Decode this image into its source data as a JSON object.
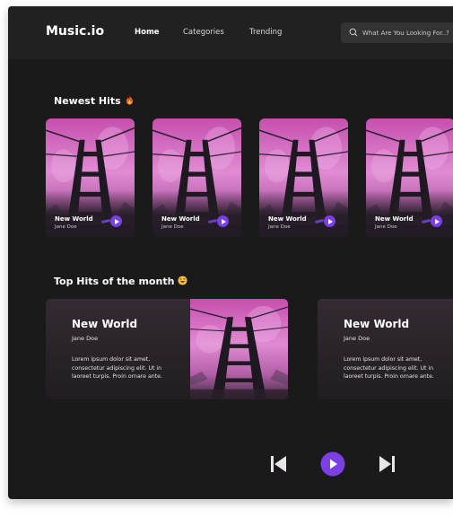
{
  "app": {
    "logo": "Music.io"
  },
  "nav": {
    "items": [
      "Home",
      "Categories",
      "Trending"
    ],
    "active": "Home"
  },
  "search": {
    "placeholder": "What Are You Looking For..?"
  },
  "newest": {
    "title": "Newest Hits",
    "emoji_icon": "fire-icon",
    "cards": [
      {
        "title": "New World",
        "artist": "Jane Doe"
      },
      {
        "title": "New World",
        "artist": "Jane Doe"
      },
      {
        "title": "New World",
        "artist": "Jane Doe"
      },
      {
        "title": "New World",
        "artist": "Jane Doe"
      }
    ]
  },
  "top_month": {
    "title": "Top Hits of the month",
    "emoji_icon": "grinning-face-icon",
    "cards": [
      {
        "title": "New World",
        "artist": "Jane Doe",
        "description": "Lorem ipsum dolor sit amet, consectetur adipiscing elit. Ut in laoreet turpis. Proin ornare ante."
      },
      {
        "title": "New World",
        "artist": "Jane Doe",
        "description": "Lorem ipsum dolor sit amet, consectetur adipiscing elit. Ut in laoreet turpis. Proin ornare ante."
      }
    ]
  },
  "player": {
    "icons": [
      "previous-icon",
      "play-icon",
      "next-icon"
    ]
  },
  "colors": {
    "accent": "#7b3fe4",
    "background": "#1b1a1b",
    "topbar": "#222122"
  }
}
